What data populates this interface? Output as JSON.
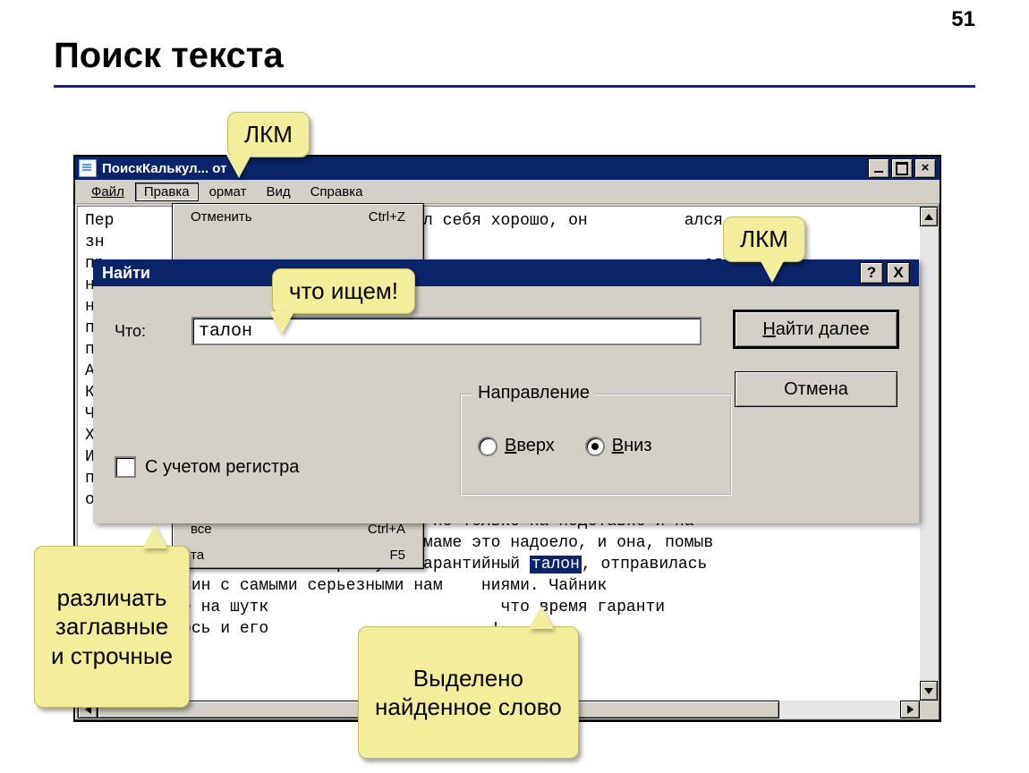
{
  "page_number": "51",
  "slide_title": "Поиск текста",
  "window": {
    "title_text": "ПоискКалькул...            от",
    "menubar": {
      "file": "Файл",
      "edit": "Правка",
      "format": "ормат",
      "view": "Вид",
      "help": "Справка"
    },
    "dropdown": {
      "undo_label": "Отменить",
      "undo_shortcut": "Ctrl+Z",
      "selectall_label": "все",
      "selectall_shortcut": "Ctrl+A",
      "date_label": "та",
      "date_shortcut": "F5"
    },
    "textarea_lines": {
      "l1": "Пер                        айник вел себя хорошо, он          ался,",
      "l2": "зн",
      "l3": "пр                                                              ся",
      "l4": "на",
      "l5": "на",
      "l6": "по",
      "l7": "пр",
      "l8": "А",
      "l9": "Ко",
      "l10": "Ча",
      "l11": "Хо",
      "l12": "И",
      "l13": "по",
      "l14": "от",
      "l15": "                          лужи были не только на подставке и на",
      "l16": "                          Наконец, маме это надоело, и она, помыв",
      "l17a": "                         оробку и гарантийный ",
      "l17b": "талон",
      "l17c": ", отправилась",
      "l18": "          зин с самыми серьезными нам    ниями. Чайник",
      "l19": "          е на шутк                        что время гаранти",
      "l20": "          ось и его                       !"
    }
  },
  "find_dialog": {
    "title": "Найти",
    "help_glyph": "?",
    "close_glyph": "X",
    "what_label": "Что:",
    "input_value": "талон",
    "find_next_prefix": "Н",
    "find_next_rest": "айти далее",
    "cancel_label": "Отмена",
    "case_checkbox_label": "С учетом регистра",
    "group_legend": "Направление",
    "radio_up_prefix": "В",
    "radio_up_rest": "верх",
    "radio_down_prefix": "В",
    "radio_down_rest": "низ"
  },
  "callouts": {
    "lkm1": "ЛКМ",
    "lkm2": "ЛКМ",
    "what_search": "что ищем!",
    "case_note": "различать\nзаглавные\nи строчные",
    "found_note": "Выделено\nнайденное слово"
  }
}
